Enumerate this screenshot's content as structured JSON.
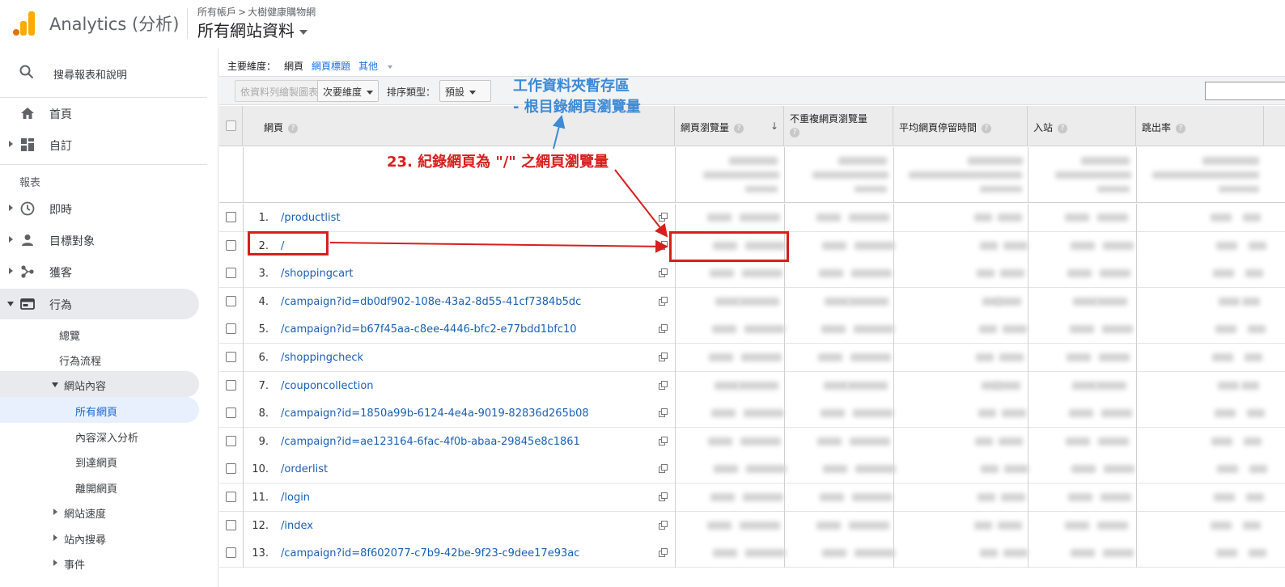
{
  "header": {
    "app_title": "Analytics (分析)",
    "breadcrumb_account": "所有帳戶",
    "breadcrumb_property": "大樹健康購物網",
    "view_name": "所有網站資料"
  },
  "sidebar": {
    "search_text": "搜尋報表和說明",
    "home": "首頁",
    "custom": "自訂",
    "reports_label": "報表",
    "realtime": "即時",
    "audience": "目標對象",
    "acquisition": "獲客",
    "behavior": "行為",
    "behavior_sub": {
      "overview": "總覽",
      "flow": "行為流程",
      "site_content": "網站內容",
      "all_pages": "所有網頁",
      "drilldown": "內容深入分析",
      "landing": "到達網頁",
      "exit": "離開網頁",
      "site_speed": "網站速度",
      "site_search": "站內搜尋",
      "events": "事件"
    }
  },
  "dimensions": {
    "label": "主要維度：",
    "current": "網頁",
    "page_title": "網頁標題",
    "other": "其他"
  },
  "toolbar": {
    "plot_rows": "依資料列繪製圖表",
    "secondary_dim": "次要維度",
    "sort_type_label": "排序類型：",
    "sort_value": "預設"
  },
  "table": {
    "headers": {
      "page": "網頁",
      "pageviews": "網頁瀏覽量",
      "unique_pageviews": "不重複網頁瀏覽量",
      "avg_time": "平均網頁停留時間",
      "entrances": "入站",
      "bounce_rate": "跳出率"
    },
    "rows": [
      {
        "n": "1.",
        "page": "/productlist"
      },
      {
        "n": "2.",
        "page": "/"
      },
      {
        "n": "3.",
        "page": "/shoppingcart"
      },
      {
        "n": "4.",
        "page": "/campaign?id=db0df902-108e-43a2-8d55-41cf7384b5dc"
      },
      {
        "n": "5.",
        "page": "/campaign?id=b67f45aa-c8ee-4446-bfc2-e77bdd1bfc10"
      },
      {
        "n": "6.",
        "page": "/shoppingcheck"
      },
      {
        "n": "7.",
        "page": "/couponcollection"
      },
      {
        "n": "8.",
        "page": "/campaign?id=1850a99b-6124-4e4a-9019-82836d265b08"
      },
      {
        "n": "9.",
        "page": "/campaign?id=ae123164-6fac-4f0b-abaa-29845e8c1861"
      },
      {
        "n": "10.",
        "page": "/orderlist"
      },
      {
        "n": "11.",
        "page": "/login"
      },
      {
        "n": "12.",
        "page": "/index"
      },
      {
        "n": "13.",
        "page": "/campaign?id=8f602077-c7b9-42be-9f23-c9dee17e93ac"
      }
    ]
  },
  "annotations": {
    "red_note": "23. 紀錄網頁為 \"/\" 之網頁瀏覽量",
    "blue_note_line1": "工作資料夾暫存區",
    "blue_note_line2": "- 根目錄網頁瀏覽量"
  },
  "colors": {
    "annotation_red": "#d81e1e",
    "annotation_blue": "#3d8ad6",
    "logo_orange": "#f9ab00",
    "logo_dark_orange": "#e37400"
  }
}
